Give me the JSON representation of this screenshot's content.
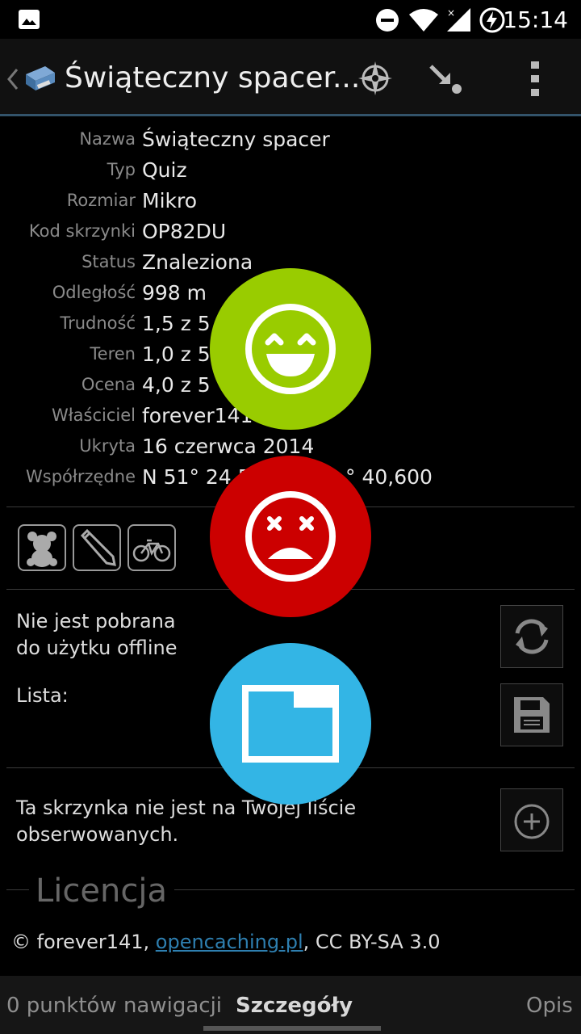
{
  "status_bar": {
    "time": "15:14"
  },
  "action_bar": {
    "title": "Świąteczny spacer..."
  },
  "details": [
    {
      "label": "Nazwa",
      "value": "Świąteczny spacer"
    },
    {
      "label": "Typ",
      "value": "Quiz"
    },
    {
      "label": "Rozmiar",
      "value": "Mikro"
    },
    {
      "label": "Kod skrzynki",
      "value": "OP82DU"
    },
    {
      "label": "Status",
      "value": "Znaleziona"
    },
    {
      "label": "Odległość",
      "value": "998 m"
    },
    {
      "label": "Trudność",
      "value": "1,5 z 5"
    },
    {
      "label": "Teren",
      "value": "1,0 z 5"
    },
    {
      "label": "Ocena",
      "value": "4,0 z 5"
    },
    {
      "label": "Właściciel",
      "value": "forever141"
    },
    {
      "label": "Ukryta",
      "value": "16 czerwca 2014"
    },
    {
      "label": "Współrzędne",
      "value": "N 51° 24 5"
    },
    {
      "label": "",
      "value": "° 40,600"
    }
  ],
  "offline": {
    "line1": "Nie jest pobrana",
    "line2": "do użytku offline"
  },
  "list": {
    "label": "Lista:"
  },
  "watchlist": {
    "line1": "Ta skrzynka nie jest na Tw",
    "line1b": "ojej liście",
    "line2": "obserwowanych."
  },
  "license": {
    "title": "Licencja",
    "owner": "© forever141, ",
    "link": "opencaching.pl",
    "rest": ", CC BY-SA 3.0"
  },
  "tabs": {
    "left": "0 punktów nawigacji",
    "center": "Szczegóły",
    "right": "Opis"
  },
  "colors": {
    "found_fab": "#99cc00",
    "dnf_fab": "#cc0000",
    "note_fab": "#33b5e5"
  }
}
